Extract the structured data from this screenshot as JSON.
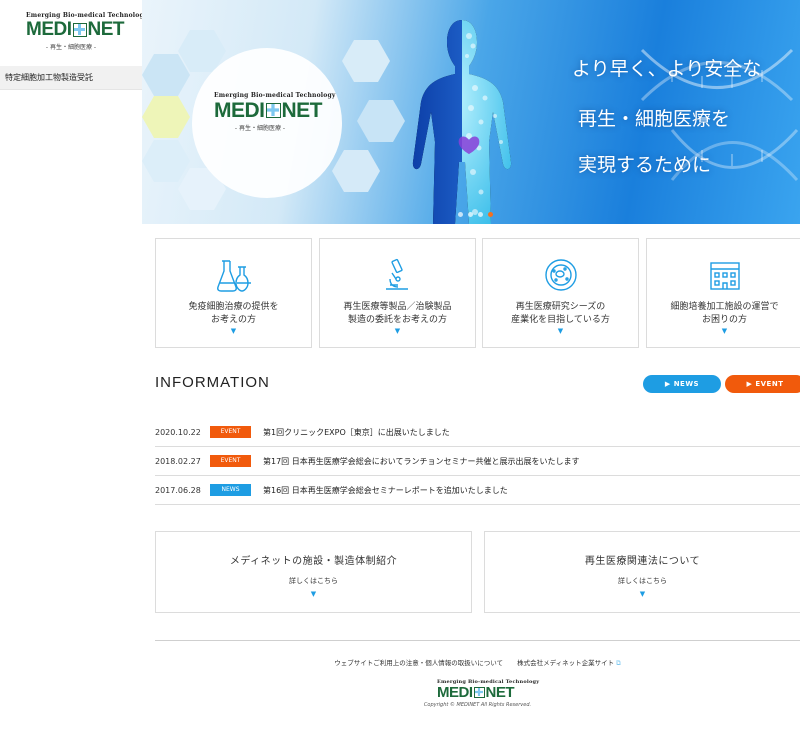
{
  "brand": {
    "tagline": "Emerging Bio-medical Technology",
    "word_left": "MEDI",
    "word_right": "NET",
    "sub": "- 再生・細胞医療 -",
    "color": "#1d6a3b"
  },
  "sidebar": {
    "menu_item": "特定細胞加工物製造受託"
  },
  "hero": {
    "lines": [
      "より早く、より安全な",
      "再生・細胞医療を",
      "実現するために"
    ],
    "active_dot": 3,
    "dot_count": 4
  },
  "services": [
    {
      "line1": "免疫細胞治療の提供を",
      "line2": "お考えの方",
      "icon": "flask-icon"
    },
    {
      "line1": "再生医療等製品／治験製品",
      "line2": "製造の委託をお考えの方",
      "icon": "microscope-icon"
    },
    {
      "line1": "再生医療研究シーズの",
      "line2": "産業化を目指している方",
      "icon": "cell-icon"
    },
    {
      "line1": "細胞培養加工施設の運営で",
      "line2": "お困りの方",
      "icon": "building-icon"
    }
  ],
  "info": {
    "title": "INFORMATION",
    "news_button": "▶ NEWS",
    "event_button": "▶ EVENT",
    "items": [
      {
        "date": "2020.10.22",
        "tag": "EVENT",
        "kind": "event",
        "text": "第1回クリニックEXPO［東京］に出展いたしました"
      },
      {
        "date": "2018.02.27",
        "tag": "EVENT",
        "kind": "event",
        "text": "第17回 日本再生医療学会総会においてランチョンセミナー共催と展示出展をいたします"
      },
      {
        "date": "2017.06.28",
        "tag": "NEWS",
        "kind": "news",
        "text": "第16回 日本再生医療学会総会セミナーレポートを追加いたしました"
      }
    ]
  },
  "boxes": [
    {
      "title": "メディネットの施設・製造体制紹介",
      "link": "詳しくはこちら"
    },
    {
      "title": "再生医療関連法について",
      "link": "詳しくはこちら"
    }
  ],
  "footer": {
    "link1": "ウェブサイトご利用上の注意・個人情報の取扱いについて",
    "link2": "株式会社メディネット企業サイト",
    "copyright": "Copyright © MEDINET All Rights Reserved."
  },
  "colors": {
    "accent_blue": "#1e9de3",
    "accent_orange": "#f15a0c"
  }
}
